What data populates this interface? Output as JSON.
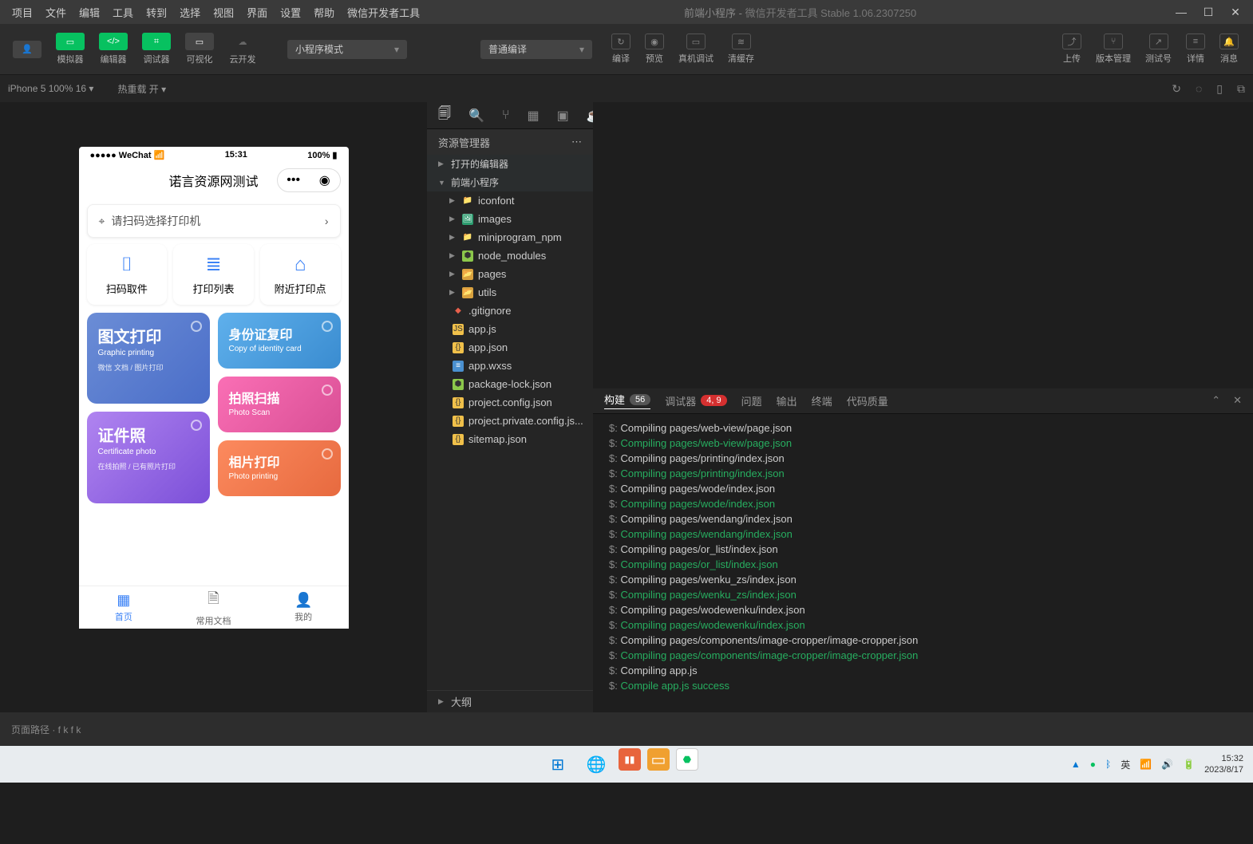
{
  "titlebar": {
    "menus": [
      "项目",
      "文件",
      "编辑",
      "工具",
      "转到",
      "选择",
      "视图",
      "界面",
      "设置",
      "帮助",
      "微信开发者工具"
    ],
    "project": "前端小程序",
    "app": "微信开发者工具 Stable 1.06.2307250"
  },
  "toolbar": {
    "avatar": "avatar",
    "btns": [
      {
        "label": "模拟器",
        "color": "green",
        "icon": "▭"
      },
      {
        "label": "编辑器",
        "color": "green",
        "icon": "</>"
      },
      {
        "label": "调试器",
        "color": "green",
        "icon": "⌗"
      },
      {
        "label": "可视化",
        "color": "dark",
        "icon": "▭"
      },
      {
        "label": "云开发",
        "color": "",
        "icon": "☁"
      }
    ],
    "mode": "小程序模式",
    "compile": "普通编译",
    "actions": [
      {
        "label": "编译",
        "icon": "↻"
      },
      {
        "label": "预览",
        "icon": "◉"
      },
      {
        "label": "真机调试",
        "icon": "▭"
      },
      {
        "label": "清缓存",
        "icon": "≋"
      }
    ],
    "right": [
      {
        "label": "上传",
        "icon": "⤴"
      },
      {
        "label": "版本管理",
        "icon": "⑂"
      },
      {
        "label": "测试号",
        "icon": "↗"
      },
      {
        "label": "详情",
        "icon": "≡"
      },
      {
        "label": "消息",
        "icon": "🔔"
      }
    ]
  },
  "simbar": {
    "device": "iPhone 5 100% 16",
    "reload": "热重载 开"
  },
  "phone": {
    "carrier": "●●●●● WeChat 📶",
    "time": "15:31",
    "battery": "100% ▮",
    "title": "诺言资源网测试",
    "search": "请扫码选择打印机",
    "actions": [
      {
        "label": "扫码取件",
        "icon": "⌷"
      },
      {
        "label": "打印列表",
        "icon": "≣"
      },
      {
        "label": "附近打印点",
        "icon": "⌂"
      }
    ],
    "cards": {
      "c1": {
        "h": "图文打印",
        "s": "Graphic printing",
        "d": "微信 文档 / 图片打印"
      },
      "c2": {
        "h": "证件照",
        "s": "Certificate photo",
        "d": "在线拍照 / 已有照片打印"
      },
      "c3": {
        "h": "身份证复印",
        "s": "Copy of identity card"
      },
      "c4": {
        "h": "拍照扫描",
        "s": "Photo Scan"
      },
      "c5": {
        "h": "相片打印",
        "s": "Photo printing"
      }
    },
    "tabs": [
      {
        "label": "首页",
        "active": true,
        "icon": "▦"
      },
      {
        "label": "常用文档",
        "active": false,
        "icon": "🗎"
      },
      {
        "label": "我的",
        "active": false,
        "icon": "👤"
      }
    ]
  },
  "explorer": {
    "title": "资源管理器",
    "sections": {
      "open": "打开的编辑器",
      "proj": "前端小程序",
      "outline": "大纲"
    },
    "tree": [
      {
        "t": "folder",
        "name": "iconfont",
        "icon": "folder"
      },
      {
        "t": "folder",
        "name": "images",
        "icon": "img"
      },
      {
        "t": "folder",
        "name": "miniprogram_npm",
        "icon": "folder"
      },
      {
        "t": "folder",
        "name": "node_modules",
        "icon": "node"
      },
      {
        "t": "folder",
        "name": "pages",
        "icon": "util"
      },
      {
        "t": "folder",
        "name": "utils",
        "icon": "util"
      },
      {
        "t": "file",
        "name": ".gitignore",
        "icon": "gi"
      },
      {
        "t": "file",
        "name": "app.js",
        "icon": "js"
      },
      {
        "t": "file",
        "name": "app.json",
        "icon": "json"
      },
      {
        "t": "file",
        "name": "app.wxss",
        "icon": "wxss"
      },
      {
        "t": "file",
        "name": "package-lock.json",
        "icon": "node"
      },
      {
        "t": "file",
        "name": "project.config.json",
        "icon": "json"
      },
      {
        "t": "file",
        "name": "project.private.config.js...",
        "icon": "json"
      },
      {
        "t": "file",
        "name": "sitemap.json",
        "icon": "json"
      }
    ]
  },
  "console": {
    "tabs": [
      {
        "label": "构建",
        "badge": "56",
        "active": true
      },
      {
        "label": "调试器",
        "badge": "4, 9",
        "red": true
      },
      {
        "label": "问题"
      },
      {
        "label": "输出"
      },
      {
        "label": "终端"
      },
      {
        "label": "代码质量"
      }
    ],
    "lines": [
      {
        "c": "w",
        "t": "Compiling pages/web-view/page.json"
      },
      {
        "c": "g",
        "t": "Compiling pages/web-view/page.json"
      },
      {
        "c": "w",
        "t": "Compiling pages/printing/index.json"
      },
      {
        "c": "g",
        "t": "Compiling pages/printing/index.json"
      },
      {
        "c": "w",
        "t": "Compiling pages/wode/index.json"
      },
      {
        "c": "g",
        "t": "Compiling pages/wode/index.json"
      },
      {
        "c": "w",
        "t": "Compiling pages/wendang/index.json"
      },
      {
        "c": "g",
        "t": "Compiling pages/wendang/index.json"
      },
      {
        "c": "w",
        "t": "Compiling pages/or_list/index.json"
      },
      {
        "c": "g",
        "t": "Compiling pages/or_list/index.json"
      },
      {
        "c": "w",
        "t": "Compiling pages/wenku_zs/index.json"
      },
      {
        "c": "g",
        "t": "Compiling pages/wenku_zs/index.json"
      },
      {
        "c": "w",
        "t": "Compiling pages/wodewenku/index.json"
      },
      {
        "c": "g",
        "t": "Compiling pages/wodewenku/index.json"
      },
      {
        "c": "w",
        "t": "Compiling pages/components/image-cropper/image-cropper.json"
      },
      {
        "c": "g",
        "t": "Compiling pages/components/image-cropper/image-cropper.json"
      },
      {
        "c": "w",
        "t": "Compiling app.js"
      },
      {
        "c": "g",
        "t": "Compile app.js success"
      }
    ]
  },
  "statusbar": {
    "left": "页面路径   ·    f    k   f    k"
  },
  "taskbar": {
    "time": "15:32",
    "date": "2023/8/17",
    "lang": "英"
  }
}
